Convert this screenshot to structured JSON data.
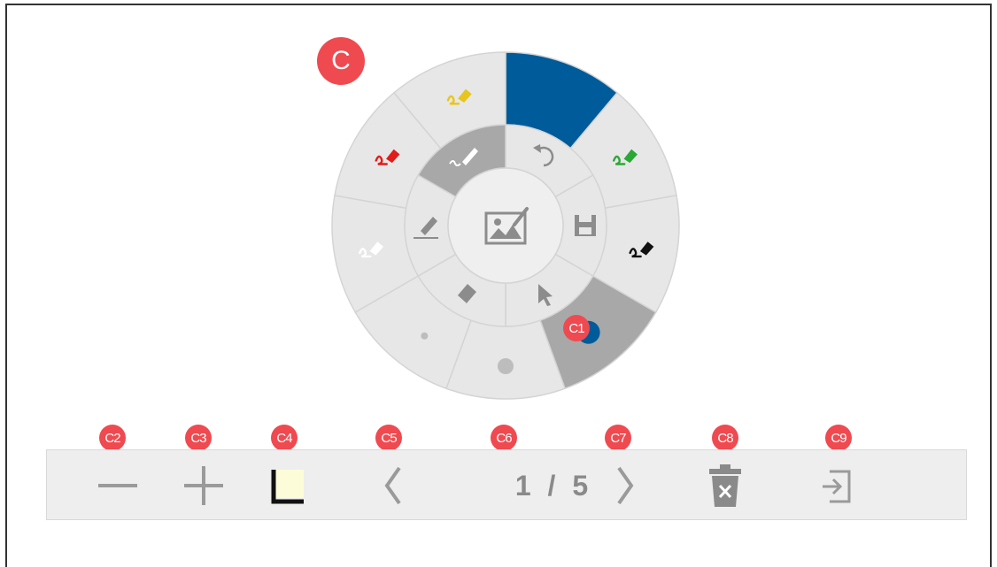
{
  "callouts": {
    "main": "C",
    "pen_size": "C1",
    "zoom_out": "C2",
    "zoom_in": "C3",
    "background": "C4",
    "prev_page": "C5",
    "page_number": "C6",
    "next_page": "C7",
    "delete_page": "C8",
    "exit": "C9"
  },
  "wheel": {
    "outer_segments": [
      {
        "name": "blue-color",
        "color": "#005b9a",
        "selected": true
      },
      {
        "name": "green-marker",
        "color": "#2aa835"
      },
      {
        "name": "black-marker",
        "color": "#111111"
      },
      {
        "name": "pen-size-large",
        "selected": true
      },
      {
        "name": "pen-size-medium"
      },
      {
        "name": "pen-size-small"
      },
      {
        "name": "white-marker",
        "color": "#ffffff"
      },
      {
        "name": "red-marker",
        "color": "#e21b1b"
      },
      {
        "name": "yellow-marker",
        "color": "#e8c51b"
      }
    ],
    "inner_tools": [
      "undo-icon",
      "save-icon",
      "pointer-icon",
      "eraser-icon",
      "highlighter-icon",
      "pen-icon"
    ],
    "center_icon": "image-icon",
    "colors": {
      "selected_inner": "#a8a8a8",
      "segment": "#e7e7e7",
      "divider": "#d4d4d4"
    }
  },
  "toolbar": {
    "page_current": "1",
    "page_separator": "/",
    "page_total": "5",
    "background_swatch": "#fcfcd8"
  }
}
